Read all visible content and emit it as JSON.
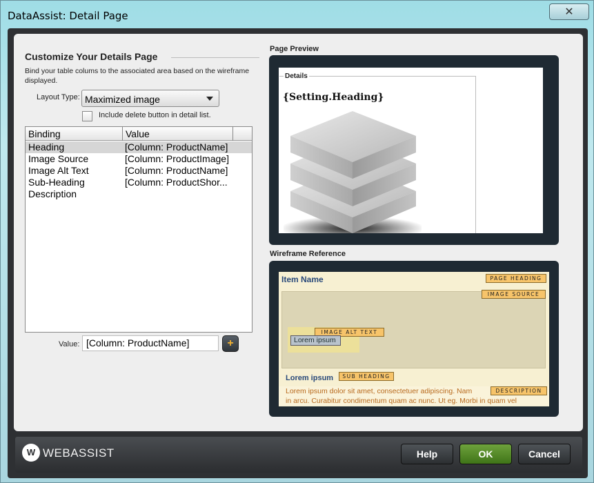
{
  "window": {
    "title": "DataAssist: Detail Page"
  },
  "left": {
    "heading": "Customize Your Details Page",
    "description": "Bind your table colums to the associated area based on the wireframe displayed.",
    "layout_label": "Layout Type:",
    "layout_value": "Maximized image",
    "checkbox_label": "Include delete button in detail list.",
    "checkbox_checked": false,
    "grid": {
      "headers": [
        "Binding",
        "Value"
      ],
      "rows": [
        {
          "binding": "Heading",
          "value": "[Column: ProductName]",
          "selected": true
        },
        {
          "binding": "Image Source",
          "value": "[Column: ProductImage]"
        },
        {
          "binding": "Image Alt Text",
          "value": "[Column: ProductName]"
        },
        {
          "binding": "Sub-Heading",
          "value": "[Column: ProductShor..."
        },
        {
          "binding": "Description",
          "value": ""
        }
      ]
    },
    "value_label": "Value:",
    "value_field": "[Column: ProductName]",
    "add_button": "+"
  },
  "preview": {
    "title": "Page Preview",
    "legend": "Details",
    "heading": "{Setting.Heading}",
    "icon": "database-icon"
  },
  "wireframe": {
    "title": "Wireframe Reference",
    "item_name": "Item Name",
    "tags": {
      "page_heading": "PAGE HEADING",
      "image_source": "IMAGE SOURCE",
      "image_alt_text": "IMAGE ALT TEXT",
      "sub_heading": "SUB HEADING",
      "description": "DESCRIPTION"
    },
    "bubble_text": "Lorem ipsum",
    "subheading": "Lorem ipsum",
    "desc_line1": "Lorem ipsum dolor sit amet, consectetuer adipiscing. Nam",
    "desc_line2": "in arcu. Curabitur condimentum quam ac nunc. Ut eg. Morbi in quam vel"
  },
  "footer": {
    "logo_mark": "W",
    "logo_text": "WEBASSIST",
    "help": "Help",
    "ok": "OK",
    "cancel": "Cancel"
  },
  "colors": {
    "ok_green": "#5a9a2a",
    "wire_tag": "#f7c46a",
    "dark_frame": "#1f2a33"
  }
}
